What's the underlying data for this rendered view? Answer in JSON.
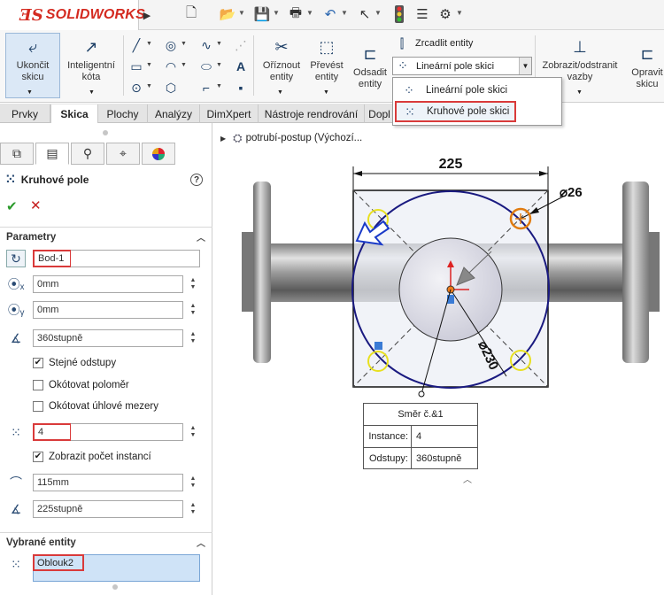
{
  "app": {
    "name": "SOLIDWORKS",
    "brand_color": "#d42a20"
  },
  "quick_access": {
    "icons": [
      "new-icon",
      "open-icon",
      "save-icon",
      "print-icon",
      "undo-icon",
      "select-icon",
      "rebuild-icon",
      "file-properties-icon",
      "options-icon"
    ]
  },
  "ribbon": {
    "exit_sketch": {
      "line1": "Ukončit",
      "line2": "skicu"
    },
    "smart_dimension": {
      "line1": "Inteligentní",
      "line2": "kóta"
    },
    "trim": {
      "line1": "Oříznout",
      "line2": "entity"
    },
    "convert": {
      "line1": "Převést",
      "line2": "entity"
    },
    "offset": {
      "line1": "Odsadit",
      "line2": "entity"
    },
    "mirror": "Zrcadlit entity",
    "pattern_selected": "Lineární pole skici",
    "relations": {
      "line1": "Zobrazit/odstranit",
      "line2": "vazby"
    },
    "repair": {
      "line1": "Opravit",
      "line2": "skicu"
    }
  },
  "pattern_menu": {
    "items": [
      "Lineární pole skici",
      "Kruhové pole skici"
    ],
    "highlighted": "Kruhové pole skici"
  },
  "tabs": {
    "items": [
      "Prvky",
      "Skica",
      "Plochy",
      "Analýzy",
      "DimXpert",
      "Nástroje rendrování",
      "Dopl"
    ],
    "active": "Skica"
  },
  "panel": {
    "title": "Kruhové pole",
    "parameters": {
      "header": "Parametry",
      "center": "Bod-1",
      "center_x": "0mm",
      "center_y": "0mm",
      "angle": "360stupně",
      "equal_spacing": "Stejné odstupy",
      "equal_spacing_checked": true,
      "dim_radius": "Okótovat poloměr",
      "dim_radius_checked": false,
      "dim_angular": "Okótovat úhlové mezery",
      "dim_angular_checked": false,
      "count": "4",
      "show_count": "Zobrazit počet instancí",
      "show_count_checked": true,
      "radius": "115mm",
      "arc_angle": "225stupně"
    },
    "selected": {
      "header": "Vybrané entity",
      "item": "Oblouk2"
    }
  },
  "viewport": {
    "tree_label": "potrubí-postup  (Výchozí...",
    "dims": {
      "width": "225",
      "hole": "⌀26",
      "diameter": "⌀230"
    },
    "callout": {
      "title": "Směr č.&1",
      "instance_label": "Instance:",
      "instance_value": "4",
      "spacing_label": "Odstupy:",
      "spacing_value": "360stupně"
    }
  }
}
